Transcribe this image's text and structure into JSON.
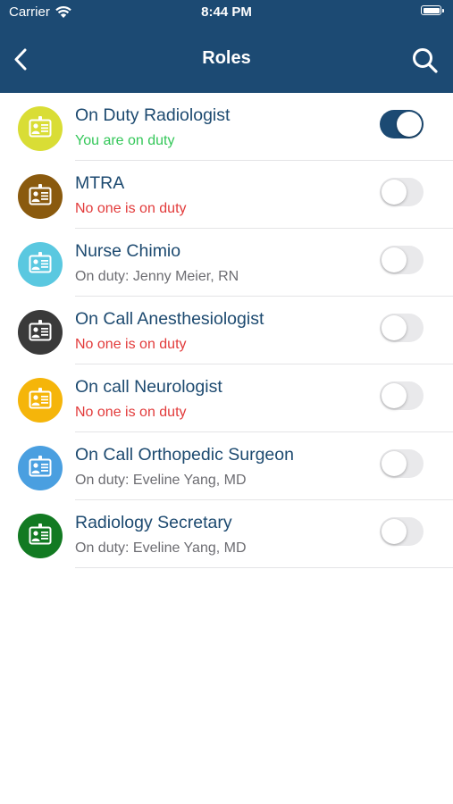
{
  "status_bar": {
    "carrier": "Carrier",
    "time": "8:44 PM"
  },
  "nav": {
    "title": "Roles",
    "back_icon": "chevron-left-icon",
    "search_icon": "search-icon"
  },
  "colors": {
    "header": "#1c4a73",
    "role_name": "#1d4a70",
    "status_on_me": "#34c759",
    "status_none": "#e23b3b",
    "status_other": "#6d6d72"
  },
  "roles": [
    {
      "name": "On Duty Radiologist",
      "status": "You are on duty",
      "status_kind": "on_me",
      "icon_color": "#d9dd35",
      "toggle_on": true
    },
    {
      "name": "MTRA",
      "status": "No one is on duty",
      "status_kind": "none",
      "icon_color": "#8a5a0e",
      "toggle_on": false
    },
    {
      "name": "Nurse Chimio",
      "status": "On duty: Jenny Meier, RN",
      "status_kind": "other",
      "icon_color": "#5ac8e0",
      "toggle_on": false
    },
    {
      "name": "On Call Anesthesiologist",
      "status": "No one is on duty",
      "status_kind": "none",
      "icon_color": "#3a3a3a",
      "toggle_on": false
    },
    {
      "name": "On call Neurologist",
      "status": "No one is on duty",
      "status_kind": "none",
      "icon_color": "#f5b50a",
      "toggle_on": false
    },
    {
      "name": "On Call Orthopedic Surgeon",
      "status": "On duty: Eveline Yang, MD",
      "status_kind": "other",
      "icon_color": "#4a9fe0",
      "toggle_on": false
    },
    {
      "name": "Radiology Secretary",
      "status": "On duty: Eveline Yang, MD",
      "status_kind": "other",
      "icon_color": "#127a22",
      "toggle_on": false
    }
  ]
}
